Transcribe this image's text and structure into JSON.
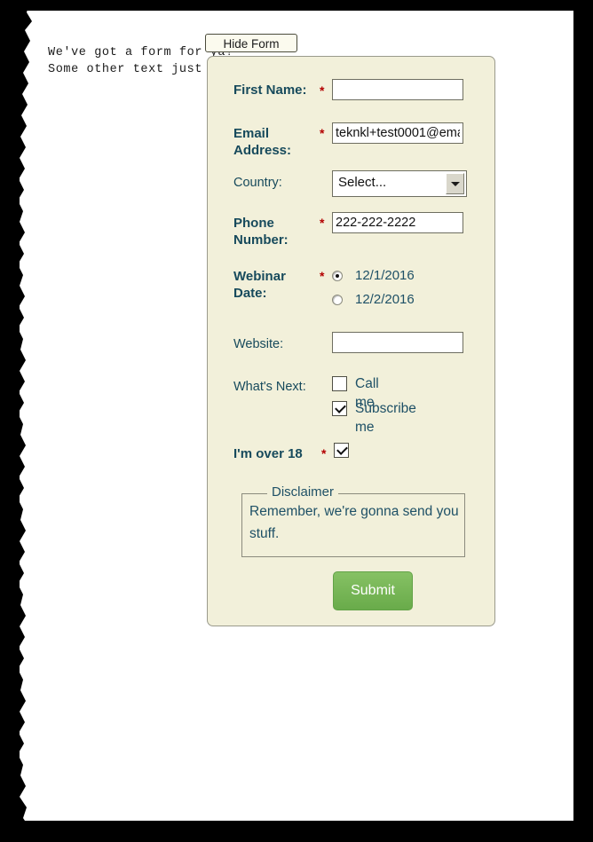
{
  "page": {
    "intro_lines": [
      "We've got a form for ya!",
      "Some other text just to show something."
    ],
    "hide_form_label": "Hide Form"
  },
  "form": {
    "fields": {
      "first_name": {
        "label": "First Name:",
        "required_marker": "*",
        "value": "",
        "placeholder": ""
      },
      "email": {
        "label": "Email Address:",
        "required_marker": "*",
        "value": "teknkl+test0001@ema",
        "placeholder": ""
      },
      "country": {
        "label": "Country:",
        "selected_option": "Select...",
        "options": [
          "Select..."
        ]
      },
      "phone": {
        "label": "Phone Number:",
        "required_marker": "*",
        "value": "222-222-2222",
        "placeholder": ""
      },
      "webinar_date": {
        "label": "Webinar Date:",
        "required_marker": "*",
        "options": [
          {
            "label": "12/1/2016",
            "selected": true
          },
          {
            "label": "12/2/2016",
            "selected": false
          }
        ]
      },
      "website": {
        "label": "Website:",
        "value": "",
        "placeholder": ""
      },
      "whats_next": {
        "label": "What's Next:",
        "options": [
          {
            "label": "Call me",
            "checked": false
          },
          {
            "label": "Subscribe me",
            "checked": true
          }
        ]
      },
      "over_18": {
        "label": "I'm over 18",
        "required_marker": "*",
        "checked": true
      }
    },
    "disclaimer": {
      "legend": "Disclaimer",
      "text": "Remember, we're gonna send you stuff."
    },
    "submit_label": "Submit"
  },
  "colors": {
    "panel_background": "#f2f0da",
    "label_text": "#1e5066",
    "required_asterisk": "#b30000",
    "submit_green": "#6fae4e",
    "page_border": "#000000"
  }
}
